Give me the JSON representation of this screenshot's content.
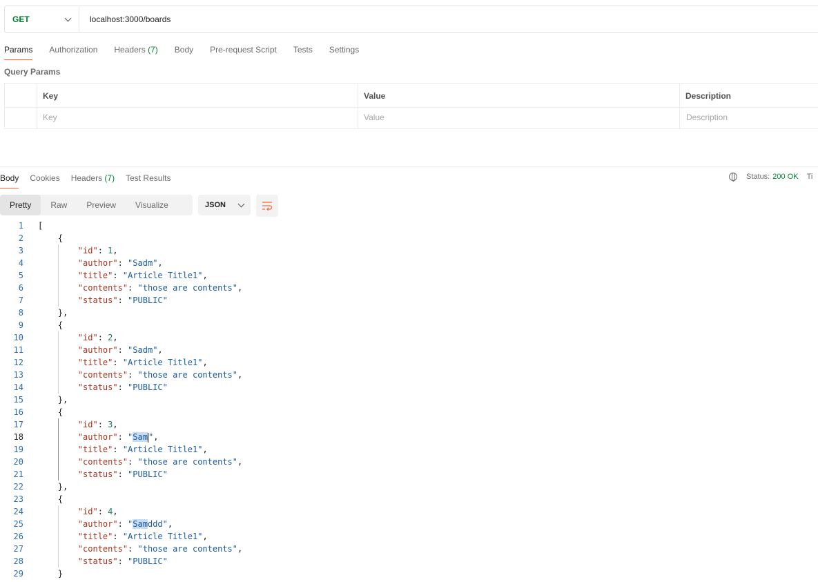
{
  "request": {
    "method": "GET",
    "url": "localhost:3000/boards"
  },
  "request_tabs": {
    "params": "Params",
    "authorization": "Authorization",
    "headers": "Headers",
    "headers_count": "(7)",
    "body": "Body",
    "prerequest": "Pre-request Script",
    "tests": "Tests",
    "settings": "Settings"
  },
  "query_params": {
    "title": "Query Params",
    "col_key": "Key",
    "col_value": "Value",
    "col_description": "Description",
    "ph_key": "Key",
    "ph_value": "Value",
    "ph_description": "Description"
  },
  "response_tabs": {
    "body": "Body",
    "cookies": "Cookies",
    "headers": "Headers",
    "headers_count": "(7)",
    "test_results": "Test Results"
  },
  "status": {
    "label": "Status:",
    "value": "200 OK",
    "more": "Ti"
  },
  "view_modes": {
    "pretty": "Pretty",
    "raw": "Raw",
    "preview": "Preview",
    "visualize": "Visualize",
    "format": "JSON"
  },
  "icons": {
    "method_dropdown": "chevron-down-icon",
    "globe": "globe-icon",
    "wrap": "wrap-lines-icon",
    "format_dropdown": "chevron-down-icon"
  },
  "colors": {
    "accent": "#ff6c37",
    "success": "#007f31",
    "json_key": "#a8321e",
    "json_string": "#1a5a9e",
    "json_number": "#1f7a64"
  },
  "response_items": [
    {
      "id": "1",
      "author": "Sadm",
      "title": "Article Title1",
      "contents": "those are contents",
      "status": "PUBLIC"
    },
    {
      "id": "2",
      "author": "Sadm",
      "title": "Article Title1",
      "contents": "those are contents",
      "status": "PUBLIC"
    },
    {
      "id": "3",
      "author": "Sam",
      "title": "Article Title1",
      "contents": "those are contents",
      "status": "PUBLIC"
    },
    {
      "id": "4",
      "author": "Samddd",
      "title": "Article Title1",
      "contents": "those are contents",
      "status": "PUBLIC"
    }
  ],
  "editor": {
    "current_line": 18,
    "selected_text": "Sam"
  }
}
